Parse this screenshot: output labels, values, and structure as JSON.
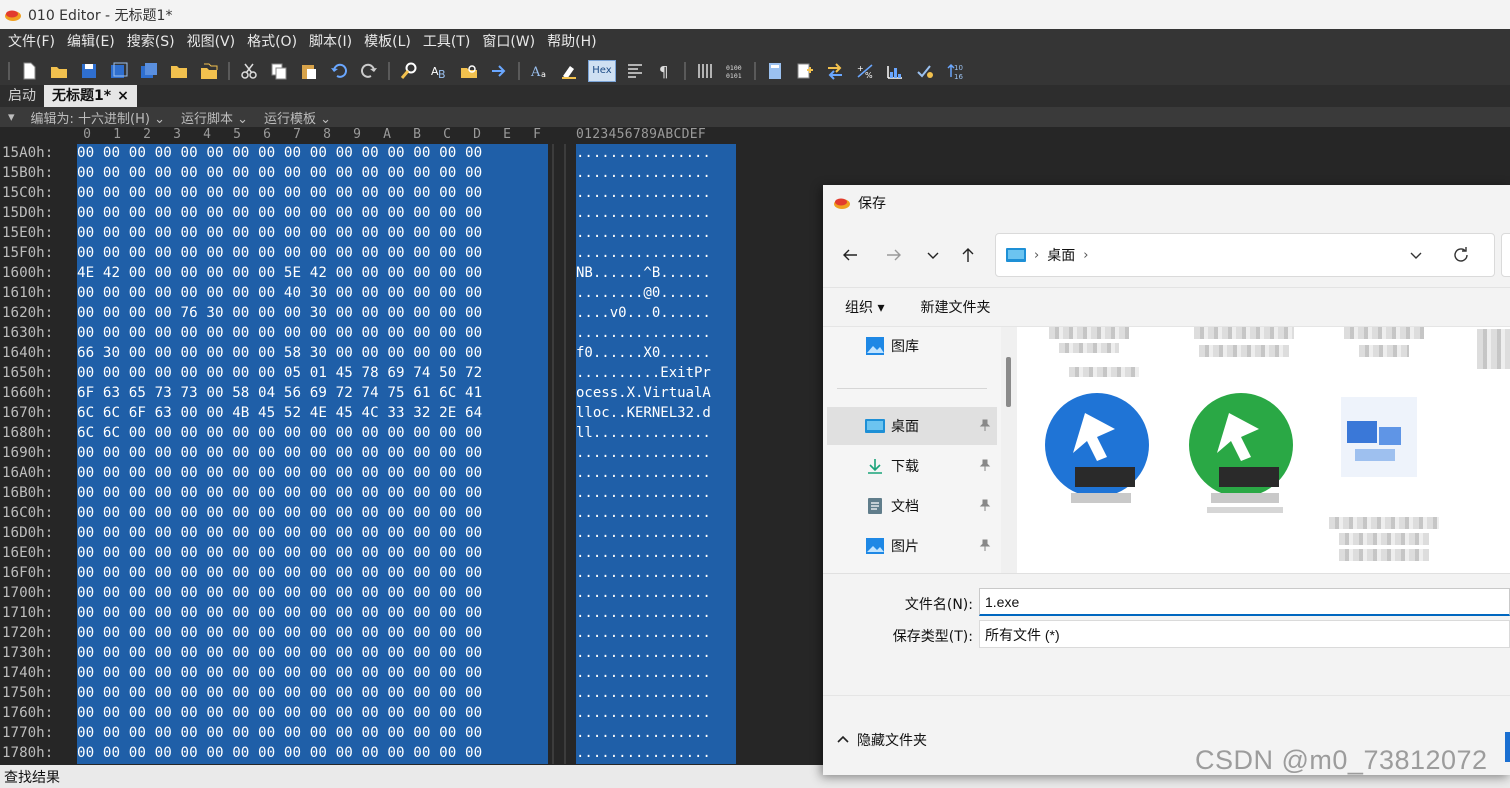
{
  "window": {
    "title": "010 Editor - 无标题1*"
  },
  "menu": [
    "文件(F)",
    "编辑(E)",
    "搜索(S)",
    "视图(V)",
    "格式(O)",
    "脚本(I)",
    "模板(L)",
    "工具(T)",
    "窗口(W)",
    "帮助(H)"
  ],
  "toolbar": {
    "hex_label": "Hex"
  },
  "tabs": [
    {
      "label": "启动"
    },
    {
      "label": "无标题1*",
      "close": "×"
    }
  ],
  "editbar": {
    "arrow": "▾",
    "edit_as": "编辑为: 十六进制(H) ⌄",
    "run_script": "运行脚本 ⌄",
    "run_template": "运行模板 ⌄"
  },
  "editor": {
    "hex_columns": [
      "0",
      "1",
      "2",
      "3",
      "4",
      "5",
      "6",
      "7",
      "8",
      "9",
      "A",
      "B",
      "C",
      "D",
      "E",
      "F"
    ],
    "ascii_header": "0123456789ABCDEF",
    "rows": [
      {
        "addr": "15A0h:",
        "hex": "00 00 00 00 00 00 00 00 00 00 00 00 00 00 00 00",
        "ascii": "................"
      },
      {
        "addr": "15B0h:",
        "hex": "00 00 00 00 00 00 00 00 00 00 00 00 00 00 00 00",
        "ascii": "................"
      },
      {
        "addr": "15C0h:",
        "hex": "00 00 00 00 00 00 00 00 00 00 00 00 00 00 00 00",
        "ascii": "................"
      },
      {
        "addr": "15D0h:",
        "hex": "00 00 00 00 00 00 00 00 00 00 00 00 00 00 00 00",
        "ascii": "................"
      },
      {
        "addr": "15E0h:",
        "hex": "00 00 00 00 00 00 00 00 00 00 00 00 00 00 00 00",
        "ascii": "................"
      },
      {
        "addr": "15F0h:",
        "hex": "00 00 00 00 00 00 00 00 00 00 00 00 00 00 00 00",
        "ascii": "................"
      },
      {
        "addr": "1600h:",
        "hex": "4E 42 00 00 00 00 00 00 5E 42 00 00 00 00 00 00",
        "ascii": "NB......^B......"
      },
      {
        "addr": "1610h:",
        "hex": "00 00 00 00 00 00 00 00 40 30 00 00 00 00 00 00",
        "ascii": "........@0......"
      },
      {
        "addr": "1620h:",
        "hex": "00 00 00 00 76 30 00 00 00 30 00 00 00 00 00 00",
        "ascii": "....v0...0......"
      },
      {
        "addr": "1630h:",
        "hex": "00 00 00 00 00 00 00 00 00 00 00 00 00 00 00 00",
        "ascii": "................"
      },
      {
        "addr": "1640h:",
        "hex": "66 30 00 00 00 00 00 00 58 30 00 00 00 00 00 00",
        "ascii": "f0......X0......"
      },
      {
        "addr": "1650h:",
        "hex": "00 00 00 00 00 00 00 00 05 01 45 78 69 74 50 72",
        "ascii": "..........ExitPr"
      },
      {
        "addr": "1660h:",
        "hex": "6F 63 65 73 73 00 58 04 56 69 72 74 75 61 6C 41",
        "ascii": "ocess.X.VirtualA"
      },
      {
        "addr": "1670h:",
        "hex": "6C 6C 6F 63 00 00 4B 45 52 4E 45 4C 33 32 2E 64",
        "ascii": "lloc..KERNEL32.d"
      },
      {
        "addr": "1680h:",
        "hex": "6C 6C 00 00 00 00 00 00 00 00 00 00 00 00 00 00",
        "ascii": "ll.............."
      },
      {
        "addr": "1690h:",
        "hex": "00 00 00 00 00 00 00 00 00 00 00 00 00 00 00 00",
        "ascii": "................"
      },
      {
        "addr": "16A0h:",
        "hex": "00 00 00 00 00 00 00 00 00 00 00 00 00 00 00 00",
        "ascii": "................"
      },
      {
        "addr": "16B0h:",
        "hex": "00 00 00 00 00 00 00 00 00 00 00 00 00 00 00 00",
        "ascii": "................"
      },
      {
        "addr": "16C0h:",
        "hex": "00 00 00 00 00 00 00 00 00 00 00 00 00 00 00 00",
        "ascii": "................"
      },
      {
        "addr": "16D0h:",
        "hex": "00 00 00 00 00 00 00 00 00 00 00 00 00 00 00 00",
        "ascii": "................"
      },
      {
        "addr": "16E0h:",
        "hex": "00 00 00 00 00 00 00 00 00 00 00 00 00 00 00 00",
        "ascii": "................"
      },
      {
        "addr": "16F0h:",
        "hex": "00 00 00 00 00 00 00 00 00 00 00 00 00 00 00 00",
        "ascii": "................"
      },
      {
        "addr": "1700h:",
        "hex": "00 00 00 00 00 00 00 00 00 00 00 00 00 00 00 00",
        "ascii": "................"
      },
      {
        "addr": "1710h:",
        "hex": "00 00 00 00 00 00 00 00 00 00 00 00 00 00 00 00",
        "ascii": "................"
      },
      {
        "addr": "1720h:",
        "hex": "00 00 00 00 00 00 00 00 00 00 00 00 00 00 00 00",
        "ascii": "................"
      },
      {
        "addr": "1730h:",
        "hex": "00 00 00 00 00 00 00 00 00 00 00 00 00 00 00 00",
        "ascii": "................"
      },
      {
        "addr": "1740h:",
        "hex": "00 00 00 00 00 00 00 00 00 00 00 00 00 00 00 00",
        "ascii": "................"
      },
      {
        "addr": "1750h:",
        "hex": "00 00 00 00 00 00 00 00 00 00 00 00 00 00 00 00",
        "ascii": "................"
      },
      {
        "addr": "1760h:",
        "hex": "00 00 00 00 00 00 00 00 00 00 00 00 00 00 00 00",
        "ascii": "................"
      },
      {
        "addr": "1770h:",
        "hex": "00 00 00 00 00 00 00 00 00 00 00 00 00 00 00 00",
        "ascii": "................"
      },
      {
        "addr": "1780h:",
        "hex": "00 00 00 00 00 00 00 00 00 00 00 00 00 00 00 00",
        "ascii": "................"
      }
    ]
  },
  "statusbar": {
    "text": "查找结果"
  },
  "dialog": {
    "title": "保存",
    "address": {
      "crumb_sep": "›",
      "path": "桌面",
      "trail_sep": "›"
    },
    "commands": {
      "organize": "组织 ▾",
      "new_folder": "新建文件夹"
    },
    "sidebar": {
      "gallery": "图库",
      "items": [
        {
          "label": "桌面",
          "icon": "desktop-icon"
        },
        {
          "label": "下载",
          "icon": "download-icon"
        },
        {
          "label": "文档",
          "icon": "document-icon"
        },
        {
          "label": "图片",
          "icon": "pictures-icon"
        }
      ]
    },
    "fields": {
      "filename_label": "文件名(N):",
      "filename_value": "1.exe",
      "filetype_label": "保存类型(T):",
      "filetype_value": "所有文件  (*)"
    },
    "footer": {
      "hide_folders": "隐藏文件夹"
    }
  },
  "watermark": "CSDN @m0_73812072",
  "colors": {
    "selection": "#1f5fa8",
    "accent": "#0067c0",
    "dark_bg": "#262626"
  }
}
